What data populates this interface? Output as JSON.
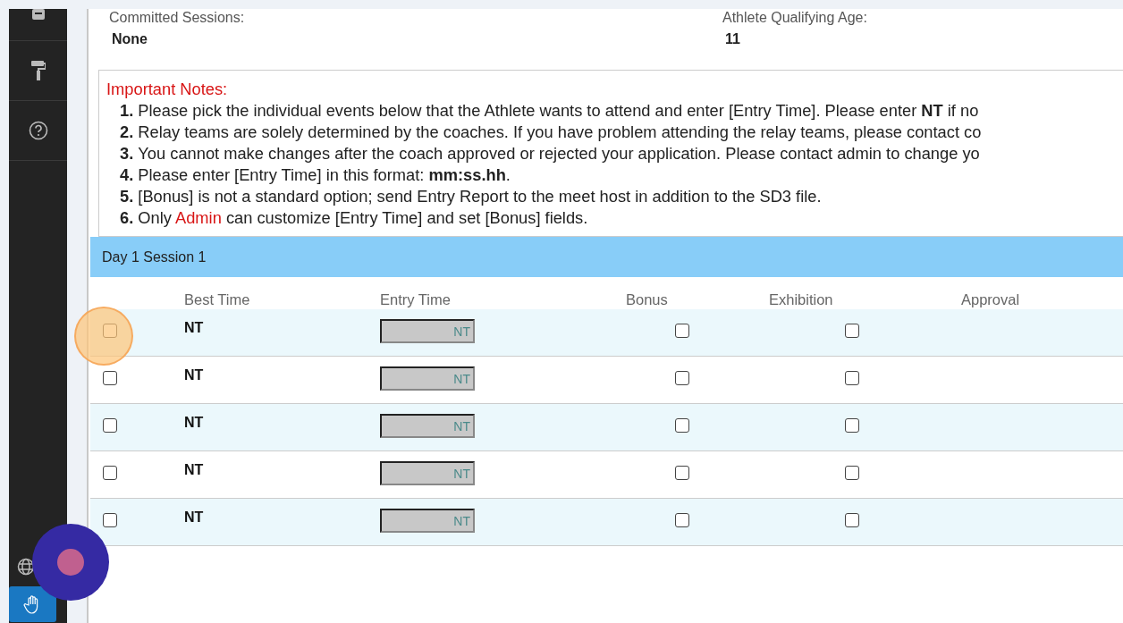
{
  "summary": {
    "committed_label": "Committed Sessions:",
    "committed_value": "None",
    "age_label": "Athlete Qualifying Age:",
    "age_value": "11"
  },
  "notes": {
    "title": "Important Notes:",
    "items": [
      {
        "number": "1.",
        "text": "Please pick the individual events below that the Athlete wants to attend and enter [Entry Time]. Please enter **NT** if no"
      },
      {
        "number": "2.",
        "text": "Relay teams are solely determined by the coaches. If you have problem attending the relay teams, please contact co"
      },
      {
        "number": "3.",
        "text": "You cannot make changes after the coach approved or rejected your application. Please contact admin to change yo"
      },
      {
        "number": "4.",
        "text": "Please enter [Entry Time] in this format: **mm:ss.hh**."
      },
      {
        "number": "5.",
        "text": "[Bonus] is not a standard option; send Entry Report to the meet host in addition to the SD3 file."
      },
      {
        "number": "6.",
        "before": "Only ",
        "highlight": "Admin",
        "after": " can customize [Entry Time] and set [Bonus] fields."
      }
    ]
  },
  "session": {
    "title": "Day 1 Session 1",
    "columns": [
      "Best Time",
      "Entry Time",
      "Bonus",
      "Exhibition",
      "Approval"
    ],
    "rows": [
      {
        "selected": false,
        "highlighted": true,
        "best_time": "NT",
        "entry_time": "NT",
        "entry_disabled": true,
        "bonus": false,
        "exhibition": false
      },
      {
        "selected": false,
        "highlighted": false,
        "best_time": "NT",
        "entry_time": "NT",
        "entry_disabled": true,
        "bonus": false,
        "exhibition": false
      },
      {
        "selected": false,
        "highlighted": false,
        "best_time": "NT",
        "entry_time": "NT",
        "entry_disabled": true,
        "bonus": false,
        "exhibition": false
      },
      {
        "selected": false,
        "highlighted": false,
        "best_time": "NT",
        "entry_time": "NT",
        "entry_disabled": true,
        "bonus": false,
        "exhibition": false
      },
      {
        "selected": false,
        "highlighted": false,
        "best_time": "NT",
        "entry_time": "NT",
        "entry_disabled": true,
        "bonus": false,
        "exhibition": false
      }
    ]
  }
}
